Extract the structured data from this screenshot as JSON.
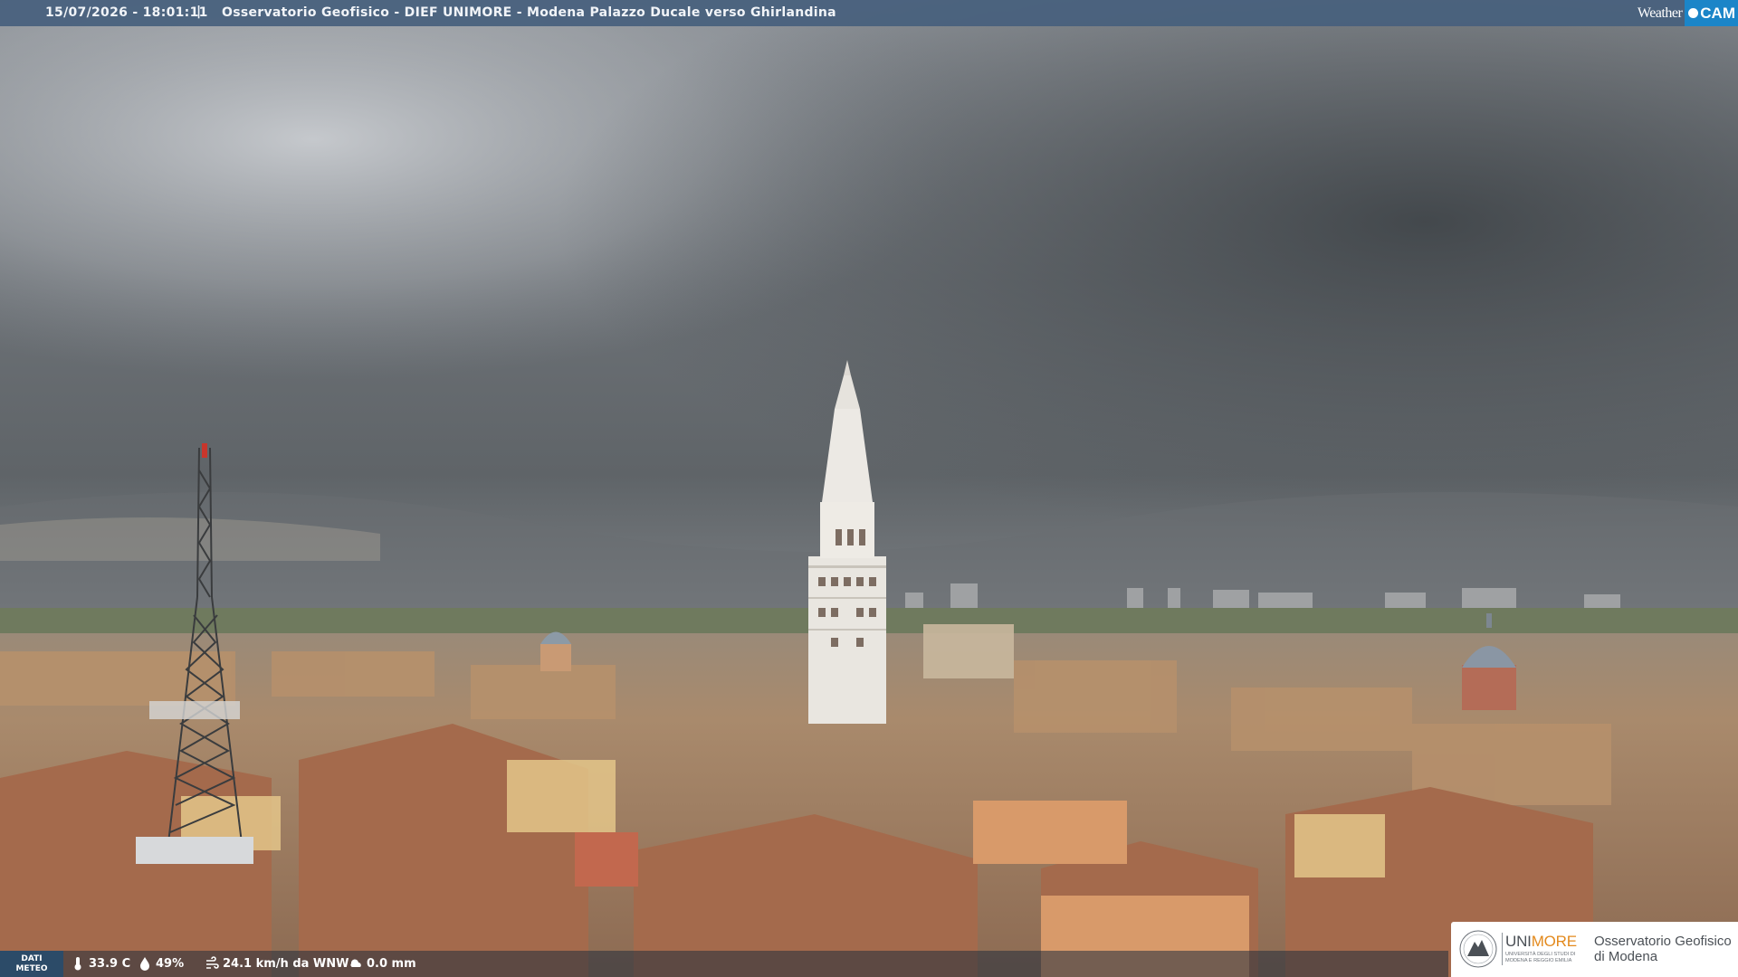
{
  "caption": {
    "timestamp": "15/07/2026 - 18:01:11",
    "separator": "|",
    "title": "Osservatorio Geofisico - DIEF UNIMORE - Modena Palazzo Ducale verso Ghirlandina"
  },
  "brand": {
    "word": "Weather",
    "cam": "CAM"
  },
  "weather": {
    "label_line1": "DATI",
    "label_line2": "METEO",
    "temperature": "33.9 C",
    "humidity": "49%",
    "wind": "24.1 km/h da WNW",
    "rain": "0.0 mm"
  },
  "institution": {
    "uni_prefix": "UNI",
    "uni_suffix": "MORE",
    "uni_subtitle": "UNIVERSITÀ DEGLI STUDI DI MODENA E REGGIO EMILIA",
    "observatory_line1": "Osservatorio Geofisico",
    "observatory_line2": "di Modena"
  },
  "icons": {
    "temperature": "thermometer-icon",
    "humidity": "water-drop-icon",
    "wind": "wind-icon",
    "rain": "rain-icon"
  }
}
